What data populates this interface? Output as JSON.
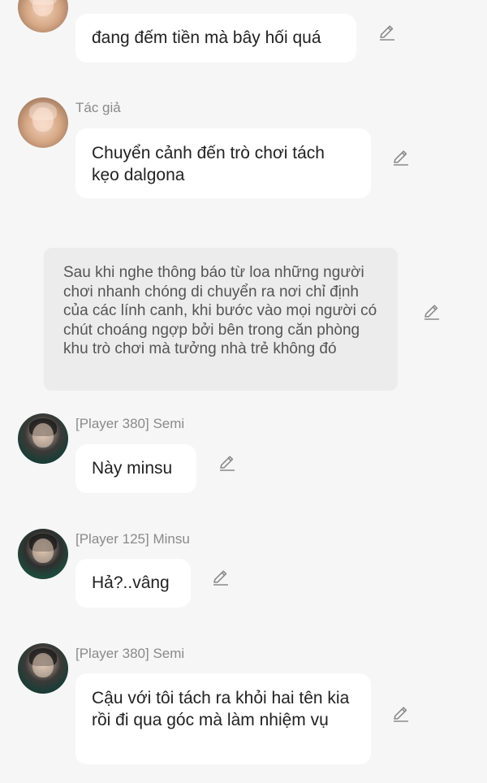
{
  "messages": [
    {
      "type": "character",
      "avatar": "cat-icon",
      "name": "",
      "text": "đang đếm tiền mà bây hối quá"
    },
    {
      "type": "character",
      "avatar": "cat-icon",
      "name": "Tác giả",
      "text": "Chuyển cảnh đến trò chơi tách kẹo dalgona"
    },
    {
      "type": "narration",
      "text": "Sau khi nghe thông báo từ loa những người chơi nhanh chóng di chuyển ra nơi chỉ định của các lính canh, khi bước vào mọi người có chút choáng ngợp bởi bên trong căn phòng khu trò chơi mà tưởng nhà trẻ không đó"
    },
    {
      "type": "character",
      "avatar": "person-icon",
      "name": "[Player 380] Semi",
      "text": "Này minsu"
    },
    {
      "type": "character",
      "avatar": "person-icon",
      "name": "[Player 125] Minsu",
      "text": "Hả?..vâng"
    },
    {
      "type": "character",
      "avatar": "person-icon",
      "name": "[Player 380] Semi",
      "text": "Cậu với tôi tách ra khỏi hai tên kia rồi đi qua góc mà làm nhiệm vụ"
    }
  ],
  "icons": {
    "edit": "pencil-icon"
  },
  "colors": {
    "background": "#f6f6f6",
    "bubble": "#ffffff",
    "narration": "#ececec",
    "name": "#8a8a8a"
  }
}
